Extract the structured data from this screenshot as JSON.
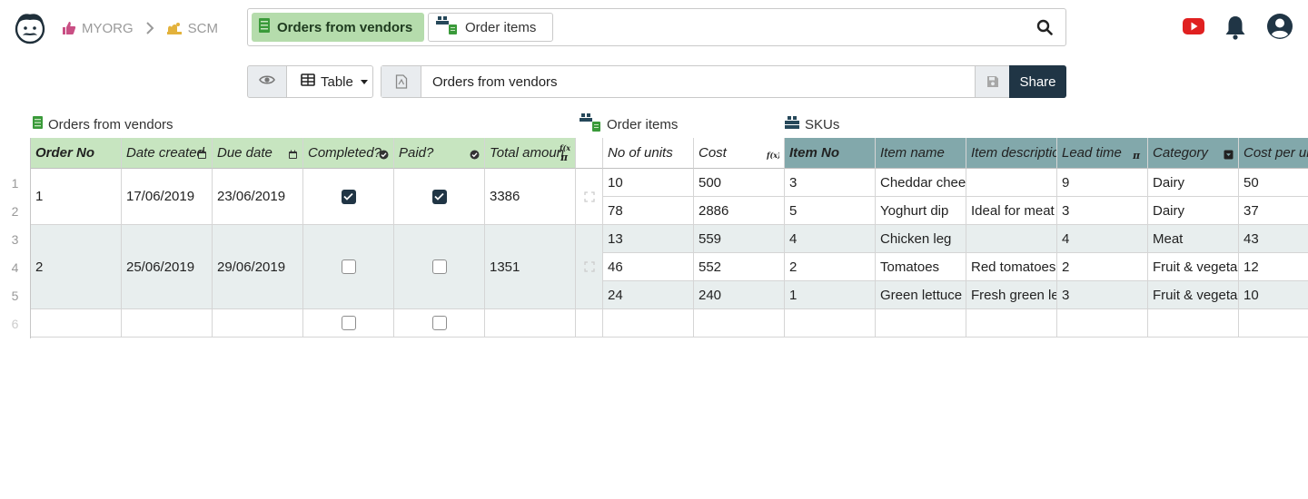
{
  "breadcrumbs": {
    "org": "MYORG",
    "doc": "SCM"
  },
  "tabs": [
    {
      "label": "Orders from vendors",
      "active": true
    },
    {
      "label": "Order items",
      "active": false
    }
  ],
  "toolbar": {
    "view_type": "Table",
    "view_name": "Orders from vendors",
    "share_label": "Share"
  },
  "sections": {
    "orders": "Orders from vendors",
    "order_items": "Order items",
    "skus": "SKUs"
  },
  "columns": {
    "order_no": "Order No",
    "date_created": "Date created",
    "due_date": "Due date",
    "completed": "Completed?",
    "paid": "Paid?",
    "total_amount": "Total amoun",
    "no_of_units": "No of units",
    "cost": "Cost",
    "item_no": "Item No",
    "item_name": "Item name",
    "item_description": "Item descriptic",
    "lead_time": "Lead time",
    "category": "Category",
    "cost_per_unit": "Cost per un"
  },
  "row_numbers": [
    "1",
    "2",
    "3",
    "4",
    "5",
    "6"
  ],
  "orders": [
    {
      "order_no": "1",
      "date_created": "17/06/2019",
      "due_date": "23/06/2019",
      "completed": true,
      "paid": true,
      "total_amount": "3386"
    },
    {
      "order_no": "2",
      "date_created": "25/06/2019",
      "due_date": "29/06/2019",
      "completed": false,
      "paid": false,
      "total_amount": "1351"
    }
  ],
  "items": [
    {
      "units": "10",
      "cost": "500",
      "item_no": "3",
      "name": "Cheddar chee",
      "desc": "",
      "lead": "9",
      "category": "Dairy",
      "cpu": "50"
    },
    {
      "units": "78",
      "cost": "2886",
      "item_no": "5",
      "name": "Yoghurt dip",
      "desc": "Ideal for meat",
      "lead": "3",
      "category": "Dairy",
      "cpu": "37"
    },
    {
      "units": "13",
      "cost": "559",
      "item_no": "4",
      "name": "Chicken leg",
      "desc": "",
      "lead": "4",
      "category": "Meat",
      "cpu": "43"
    },
    {
      "units": "46",
      "cost": "552",
      "item_no": "2",
      "name": "Tomatoes",
      "desc": "Red tomatoes",
      "lead": "2",
      "category": "Fruit & vegeta",
      "cpu": "12"
    },
    {
      "units": "24",
      "cost": "240",
      "item_no": "1",
      "name": "Green lettuce",
      "desc": "Fresh green le",
      "lead": "3",
      "category": "Fruit & vegeta",
      "cpu": "10"
    }
  ],
  "icons": {
    "logo": "grist-logo-icon",
    "org": "thumbs-up-icon",
    "doc": "doc-icon",
    "search": "search-icon",
    "youtube": "youtube-icon",
    "bell": "bell-icon",
    "user": "user-icon",
    "eye": "eye-icon",
    "table": "table-icon",
    "page": "page-icon",
    "save": "save-icon"
  },
  "colors": {
    "accent_green": "#b5dcac",
    "header_green": "#c7e5c0",
    "header_teal": "#82a8ab",
    "share_bg": "#203545",
    "row_alt": "#e8eeee"
  }
}
